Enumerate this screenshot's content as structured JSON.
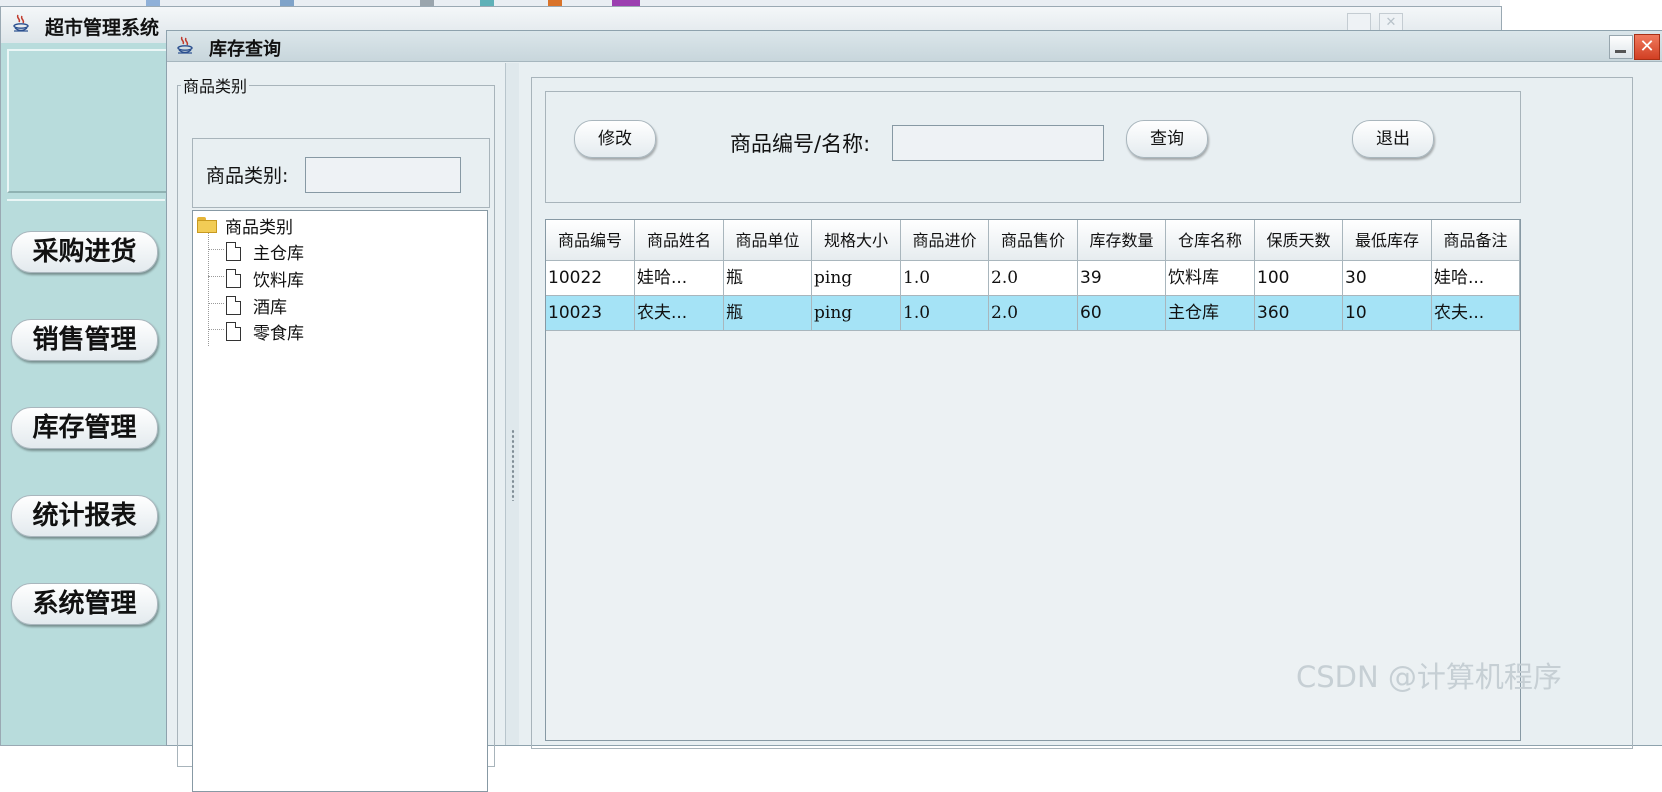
{
  "outer_window": {
    "title": "超市管理系统"
  },
  "sidebar": {
    "nav": [
      {
        "label": "采购进货"
      },
      {
        "label": "销售管理"
      },
      {
        "label": "库存管理"
      },
      {
        "label": "统计报表"
      },
      {
        "label": "系统管理"
      }
    ]
  },
  "inner_window": {
    "title": "库存查询",
    "close_symbol": "✕"
  },
  "category_panel": {
    "group_title": "商品类别",
    "search_label": "商品类别:",
    "search_value": "",
    "tree": {
      "root": "商品类别",
      "children": [
        "主仓库",
        "饮料库",
        "酒库",
        "零食库"
      ]
    }
  },
  "query_panel": {
    "modify_button": "修改",
    "search_label": "商品编号/名称:",
    "search_value": "",
    "query_button": "查询",
    "exit_button": "退出"
  },
  "table": {
    "columns": [
      "商品编号",
      "商品姓名",
      "商品单位",
      "规格大小",
      "商品进价",
      "商品售价",
      "库存数量",
      "仓库名称",
      "保质天数",
      "最低库存",
      "商品备注"
    ],
    "rows": [
      [
        "10022",
        "娃哈...",
        "瓶",
        "ping",
        "1.0",
        "2.0",
        "39",
        "饮料库",
        "100",
        "30",
        "娃哈..."
      ],
      [
        "10023",
        "农夫...",
        "瓶",
        "ping",
        "1.0",
        "2.0",
        "60",
        "主仓库",
        "360",
        "10",
        "农夫..."
      ]
    ],
    "selected_row": 1,
    "selection_color": "#a5e3f6"
  },
  "watermark": "CSDN @计算机程序"
}
